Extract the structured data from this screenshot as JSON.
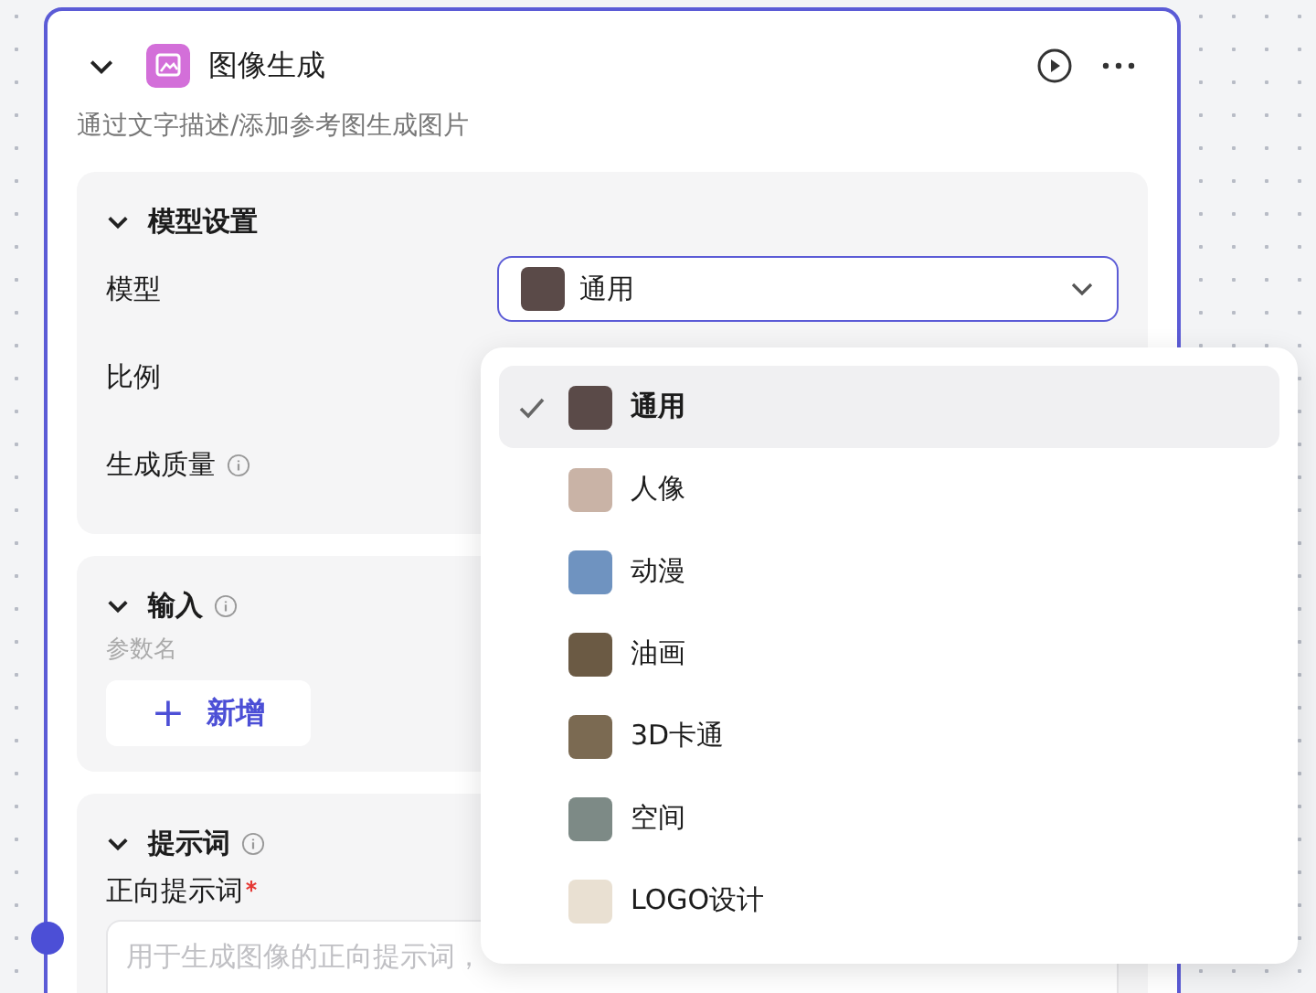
{
  "node": {
    "title": "图像生成",
    "description": "通过文字描述/添加参考图生成图片"
  },
  "model_settings": {
    "title": "模型设置",
    "expanded": true,
    "fields": [
      {
        "label": "模型",
        "kind": "select",
        "value": "通用",
        "info": false
      },
      {
        "label": "比例",
        "kind": "plain",
        "info": false
      },
      {
        "label": "生成质量",
        "kind": "plain",
        "info": true
      }
    ]
  },
  "input": {
    "title": "输入",
    "expanded": true,
    "column_label": "参数名",
    "add_button": {
      "icon": "+",
      "label": "新增"
    }
  },
  "prompt": {
    "title": "提示词",
    "expanded": true,
    "field_label": "正向提示词",
    "required": true,
    "placeholder": "用于生成图像的正向提示词，"
  },
  "model_menu": [
    {
      "label": "通用",
      "selected": true
    },
    {
      "label": "人像",
      "selected": false
    },
    {
      "label": "动漫",
      "selected": false
    },
    {
      "label": "油画",
      "selected": false
    },
    {
      "label": "3D卡通",
      "selected": false
    },
    {
      "label": "空间",
      "selected": false
    },
    {
      "label": "LOGO设计",
      "selected": false
    }
  ]
}
